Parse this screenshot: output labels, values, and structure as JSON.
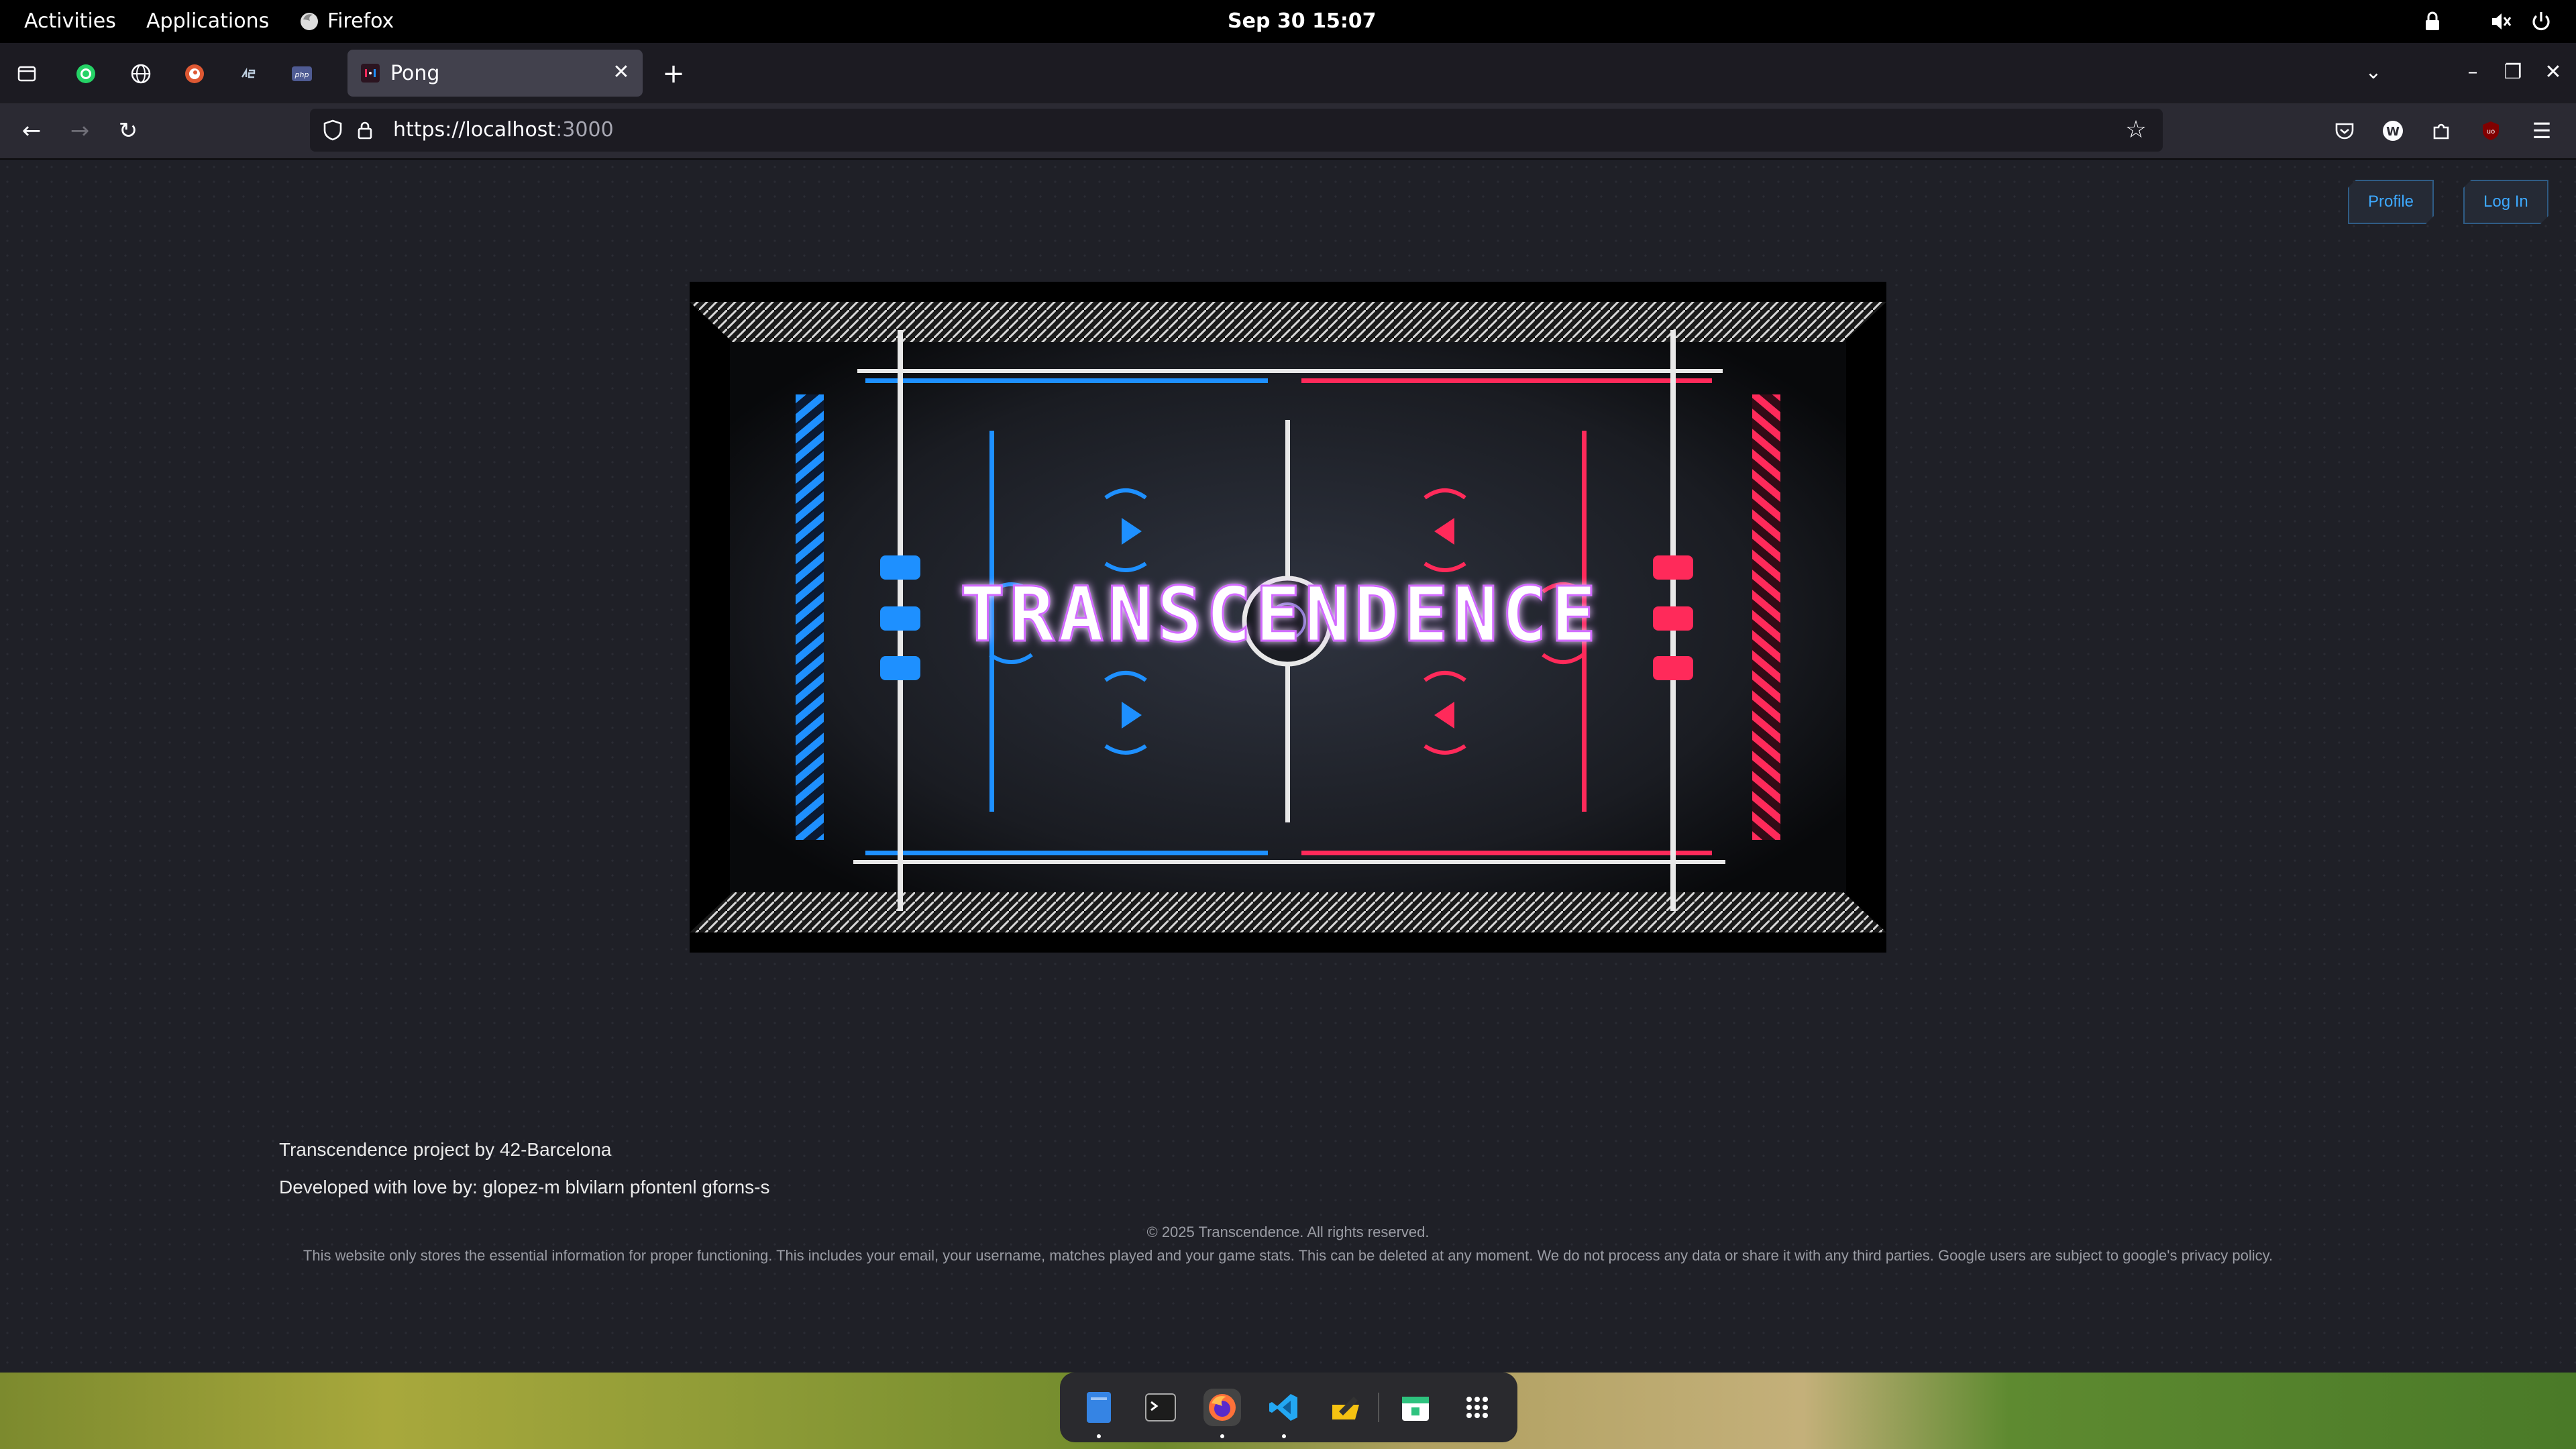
{
  "topbar": {
    "activities": "Activities",
    "applications": "Applications",
    "app_name": "Firefox",
    "clock": "Sep 30  15:07"
  },
  "browser": {
    "active_tab_title": "Pong",
    "url_main": "https://localhost",
    "url_port": ":3000"
  },
  "header": {
    "profile_label": "Profile",
    "login_label": "Log In"
  },
  "hero": {
    "logo_text": "TRANSCENDENCE",
    "accent_blue": "#1e90ff",
    "accent_red": "#ff2a5a"
  },
  "footer": {
    "credit": "Transcendence project by 42-Barcelona",
    "developers": "Developed with love by: glopez-m blvilarn pfontenl gforns-s",
    "copyright": "© 2025 Transcendence. All rights reserved.",
    "privacy": "This website only stores the essential information for proper functioning. This includes your email, your username, matches played and your game stats. This can be deleted at any moment. We do not process any data or share it with any third parties. Google users are subject to google's privacy policy."
  }
}
